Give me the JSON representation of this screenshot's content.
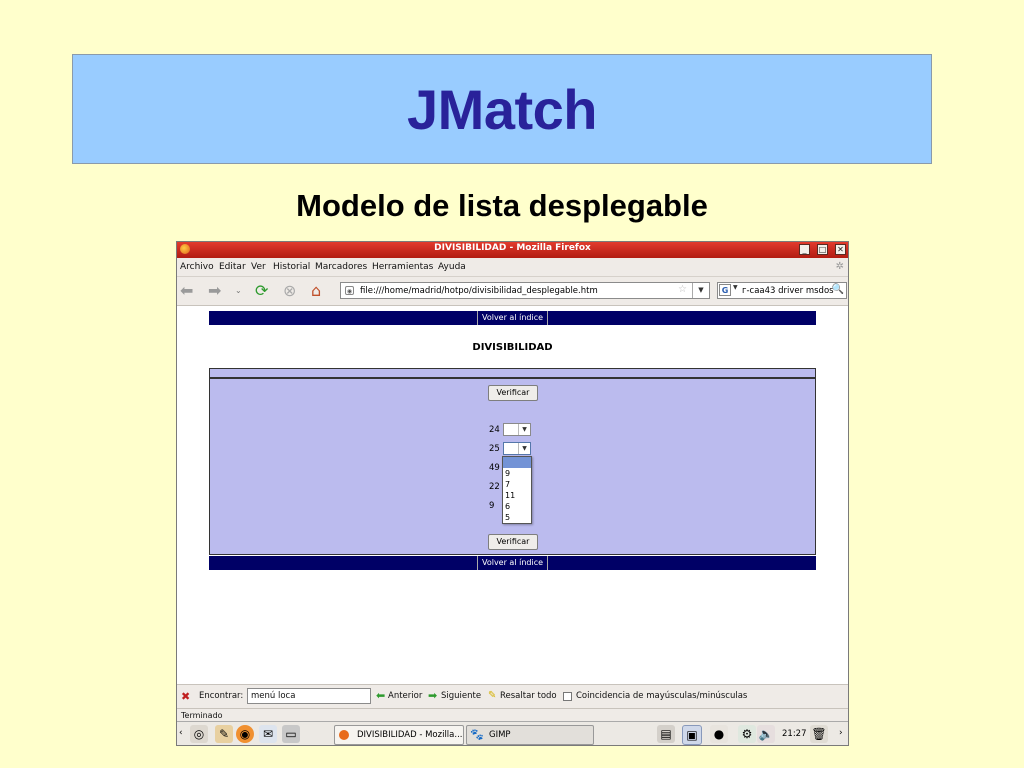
{
  "slide": {
    "title": "JMatch",
    "subtitle": "Modelo de lista desplegable"
  },
  "browser": {
    "window_title": "DIVISIBILIDAD - Mozilla Firefox",
    "menu": [
      "Archivo",
      "Editar",
      "Ver",
      "Historial",
      "Marcadores",
      "Herramientas",
      "Ayuda"
    ],
    "url": "file:///home/madrid/hotpo/divisibilidad_desplegable.htm",
    "search_text": "г-caa43 driver msdos",
    "search_engine_letter": "G",
    "status": "Terminado"
  },
  "page": {
    "nav_link": "Volver al índice",
    "exercise_title": "DIVISIBILIDAD",
    "verify_button": "Verificar",
    "questions": [
      {
        "number": "24"
      },
      {
        "number": "25"
      },
      {
        "number": "49"
      },
      {
        "number": "22"
      },
      {
        "number": "9"
      }
    ],
    "dropdown_options": [
      "",
      "9",
      "7",
      "11",
      "6",
      "5"
    ]
  },
  "findbar": {
    "label": "Encontrar:",
    "value": "menú loca",
    "previous": "Anterior",
    "next": "Siguiente",
    "highlight": "Resaltar todo",
    "match_case": "Coincidencia de mayúsculas/minúsculas"
  },
  "taskbar": {
    "tasks": [
      "DIVISIBILIDAD - Mozilla...",
      "GIMP"
    ],
    "clock": "21:27"
  },
  "colors": {
    "slide_bg": "#ffffcc",
    "title_box": "#99ccff",
    "title_text": "#29229a",
    "nav_strip": "#000066",
    "panel": "#bbbbee",
    "titlebar": "#c62a1d"
  }
}
